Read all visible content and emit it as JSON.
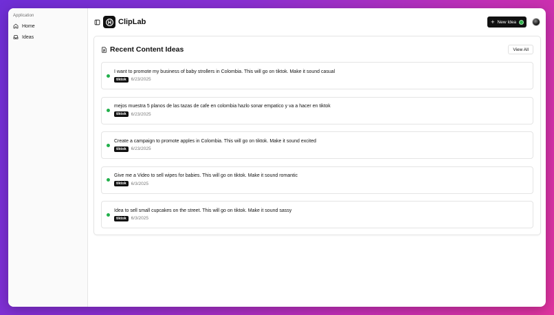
{
  "sidebar": {
    "group_label": "Application",
    "items": [
      {
        "label": "Home",
        "icon": "home-icon"
      },
      {
        "label": "Ideas",
        "icon": "inbox-icon"
      }
    ]
  },
  "header": {
    "app_title": "ClipLab",
    "new_idea_label": "New Idea",
    "status_color": "#2db34a"
  },
  "card": {
    "title": "Recent Content Ideas",
    "view_all_label": "View All"
  },
  "ideas": [
    {
      "text": "I want to promote my business of baby strollers in Colombia. This will go on tiktok. Make it sound casual",
      "tag": "tiktok",
      "date": "6/23/2025"
    },
    {
      "text": "mejos muestra 5 planos de las tazas de cafe en colombia hazlo sonar empatico y va a hacer en tiktok",
      "tag": "tiktok",
      "date": "6/23/2025"
    },
    {
      "text": "Create a campaign to promote apples in Colombia. This will go on tiktok. Make it sound excited",
      "tag": "tiktok",
      "date": "6/23/2025"
    },
    {
      "text": "Give me a Video to sell wipes for babies. This will go on tiktok. Make it sound romantic",
      "tag": "tiktok",
      "date": "6/3/2025"
    },
    {
      "text": "Idea to sell small cupcakes on the street. This will go on tiktok. Make it sound sassy",
      "tag": "tiktok",
      "date": "6/3/2025"
    }
  ],
  "colors": {
    "accent": "#111111",
    "status_green": "#22b04b"
  }
}
